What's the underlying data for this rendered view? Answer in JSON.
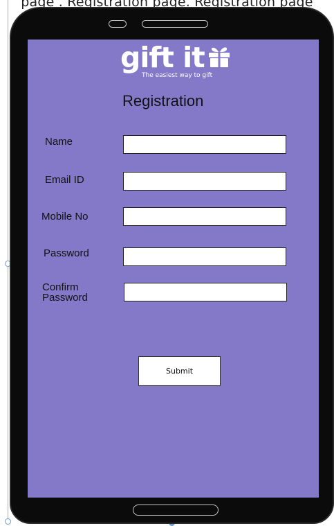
{
  "caption": "page . Registration page. Registration page",
  "app": {
    "logo_text": "gift it",
    "tagline": "The easiest way to gift"
  },
  "form": {
    "title": "Registration",
    "fields": [
      {
        "label": "Name",
        "value": "",
        "type": "text"
      },
      {
        "label": "Email ID",
        "value": "",
        "type": "email"
      },
      {
        "label": "Mobile No",
        "value": "",
        "type": "tel"
      },
      {
        "label": "Password",
        "value": "",
        "type": "password"
      },
      {
        "label": "Confirm\nPassword",
        "value": "",
        "type": "password"
      }
    ],
    "submit_label": "Submit"
  },
  "colors": {
    "screen_bg": "#8479c8",
    "device_body": "#0b0b0b",
    "logo": "#ffffff"
  },
  "icons": {
    "logo_icon": "gift-box-icon"
  }
}
